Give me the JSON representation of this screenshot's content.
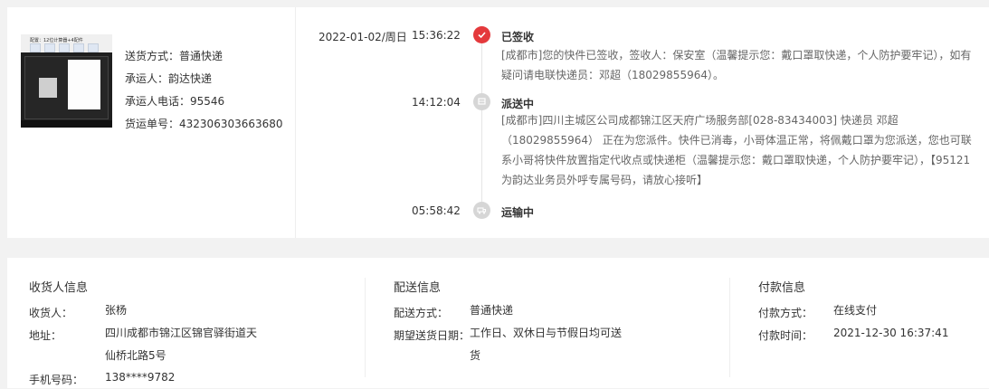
{
  "product": {
    "image_alt": "商品图片",
    "image_caption_top": "配置：12位计算器+4配件",
    "image_caption_bottom": "",
    "ship_method_label": "送货方式：",
    "ship_method": "普通快递",
    "carrier_label": "承运人：",
    "carrier": "韵达快递",
    "carrier_phone_label": "承运人电话：",
    "carrier_phone": "95546",
    "waybill_label": "货运单号：",
    "waybill": "432306303663680"
  },
  "tracking": {
    "date": "2022-01-02/周日",
    "events": [
      {
        "time": "15:36:22",
        "status": "已签收",
        "icon": "check-icon",
        "desc": "[成都市]您的快件已签收，签收人：保安室（温馨提示您：戴口罩取快递，个人防护要牢记），如有疑问请电联快递员：邓超（18029855964）。"
      },
      {
        "time": "14:12:04",
        "status": "派送中",
        "icon": "delivery-icon",
        "desc": "[成都市]四川主城区公司成都锦江区天府广场服务部[028-83434003] 快递员 邓超（18029855964） 正在为您派件。快件已消毒，小哥体温正常，将佩戴口罩为您派送，您也可联系小哥将快件放置指定代收点或快递柜（温馨提示您：戴口罩取快递，个人防护要牢记），【95121为韵达业务员外呼专属号码，请放心接听】"
      },
      {
        "time": "05:58:42",
        "status": "运输中",
        "icon": "truck-icon",
        "desc": ""
      }
    ],
    "colors": {
      "active": "#e4393c",
      "inactive": "#d6d6d6"
    }
  },
  "recipient": {
    "title": "收货人信息",
    "name_label": "收货人：",
    "name": "张杨",
    "address_label": "地址：",
    "address": "四川成都市锦江区锦官驿街道天仙桥北路5号",
    "phone_label": "手机号码：",
    "phone": "138****9782"
  },
  "delivery": {
    "title": "配送信息",
    "method_label": "配送方式：",
    "method": "普通快递",
    "expected_label": "期望送货日期：",
    "expected": "工作日、双休日与节假日均可送货"
  },
  "payment": {
    "title": "付款信息",
    "method_label": "付款方式：",
    "method": "在线支付",
    "time_label": "付款时间：",
    "time": "2021-12-30 16:37:41"
  }
}
